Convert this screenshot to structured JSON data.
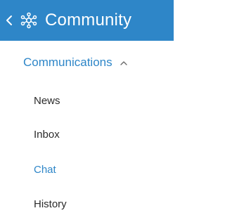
{
  "header": {
    "title": "Community",
    "back_icon": "chevron-left-icon",
    "icon": "community-network-icon",
    "background": "#2e86c8"
  },
  "section": {
    "label": "Communications",
    "expanded": true,
    "caret_icon": "chevron-up-icon"
  },
  "items": [
    {
      "label": "News",
      "active": false
    },
    {
      "label": "Inbox",
      "active": false
    },
    {
      "label": "Chat",
      "active": true
    },
    {
      "label": "History",
      "active": false
    }
  ],
  "colors": {
    "accent": "#2e86c8",
    "text": "#2b2b2b"
  }
}
